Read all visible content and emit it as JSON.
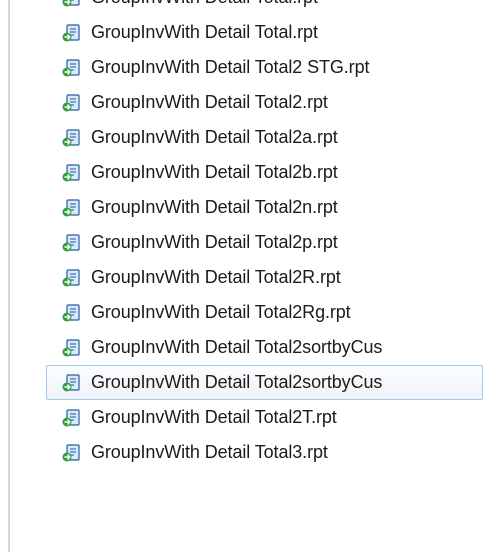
{
  "file_list": {
    "items": [
      {
        "name": "GroupInvWith Detail Total.rpt",
        "icon": "crystal-report-icon",
        "selected": false
      },
      {
        "name": "GroupInvWith Detail Total.rpt",
        "icon": "crystal-report-icon",
        "selected": false
      },
      {
        "name": "GroupInvWith Detail Total2 STG.rpt",
        "icon": "crystal-report-icon",
        "selected": false
      },
      {
        "name": "GroupInvWith Detail Total2.rpt",
        "icon": "crystal-report-icon",
        "selected": false
      },
      {
        "name": "GroupInvWith Detail Total2a.rpt",
        "icon": "crystal-report-icon",
        "selected": false
      },
      {
        "name": "GroupInvWith Detail Total2b.rpt",
        "icon": "crystal-report-icon",
        "selected": false
      },
      {
        "name": "GroupInvWith Detail Total2n.rpt",
        "icon": "crystal-report-icon",
        "selected": false
      },
      {
        "name": "GroupInvWith Detail Total2p.rpt",
        "icon": "crystal-report-icon",
        "selected": false
      },
      {
        "name": "GroupInvWith Detail Total2R.rpt",
        "icon": "crystal-report-icon",
        "selected": false
      },
      {
        "name": "GroupInvWith Detail Total2Rg.rpt",
        "icon": "crystal-report-icon",
        "selected": false
      },
      {
        "name": "GroupInvWith Detail Total2sortbyCus",
        "icon": "crystal-report-icon",
        "selected": false
      },
      {
        "name": "GroupInvWith Detail Total2sortbyCus",
        "icon": "crystal-report-icon",
        "selected": true
      },
      {
        "name": "GroupInvWith Detail Total2T.rpt",
        "icon": "crystal-report-icon",
        "selected": false
      },
      {
        "name": "GroupInvWith Detail Total3.rpt",
        "icon": "crystal-report-icon",
        "selected": false
      }
    ]
  },
  "colors": {
    "selection_border": "#a9c8e6",
    "icon_blue": "#1f5fa8",
    "icon_green": "#2f9e3a"
  }
}
